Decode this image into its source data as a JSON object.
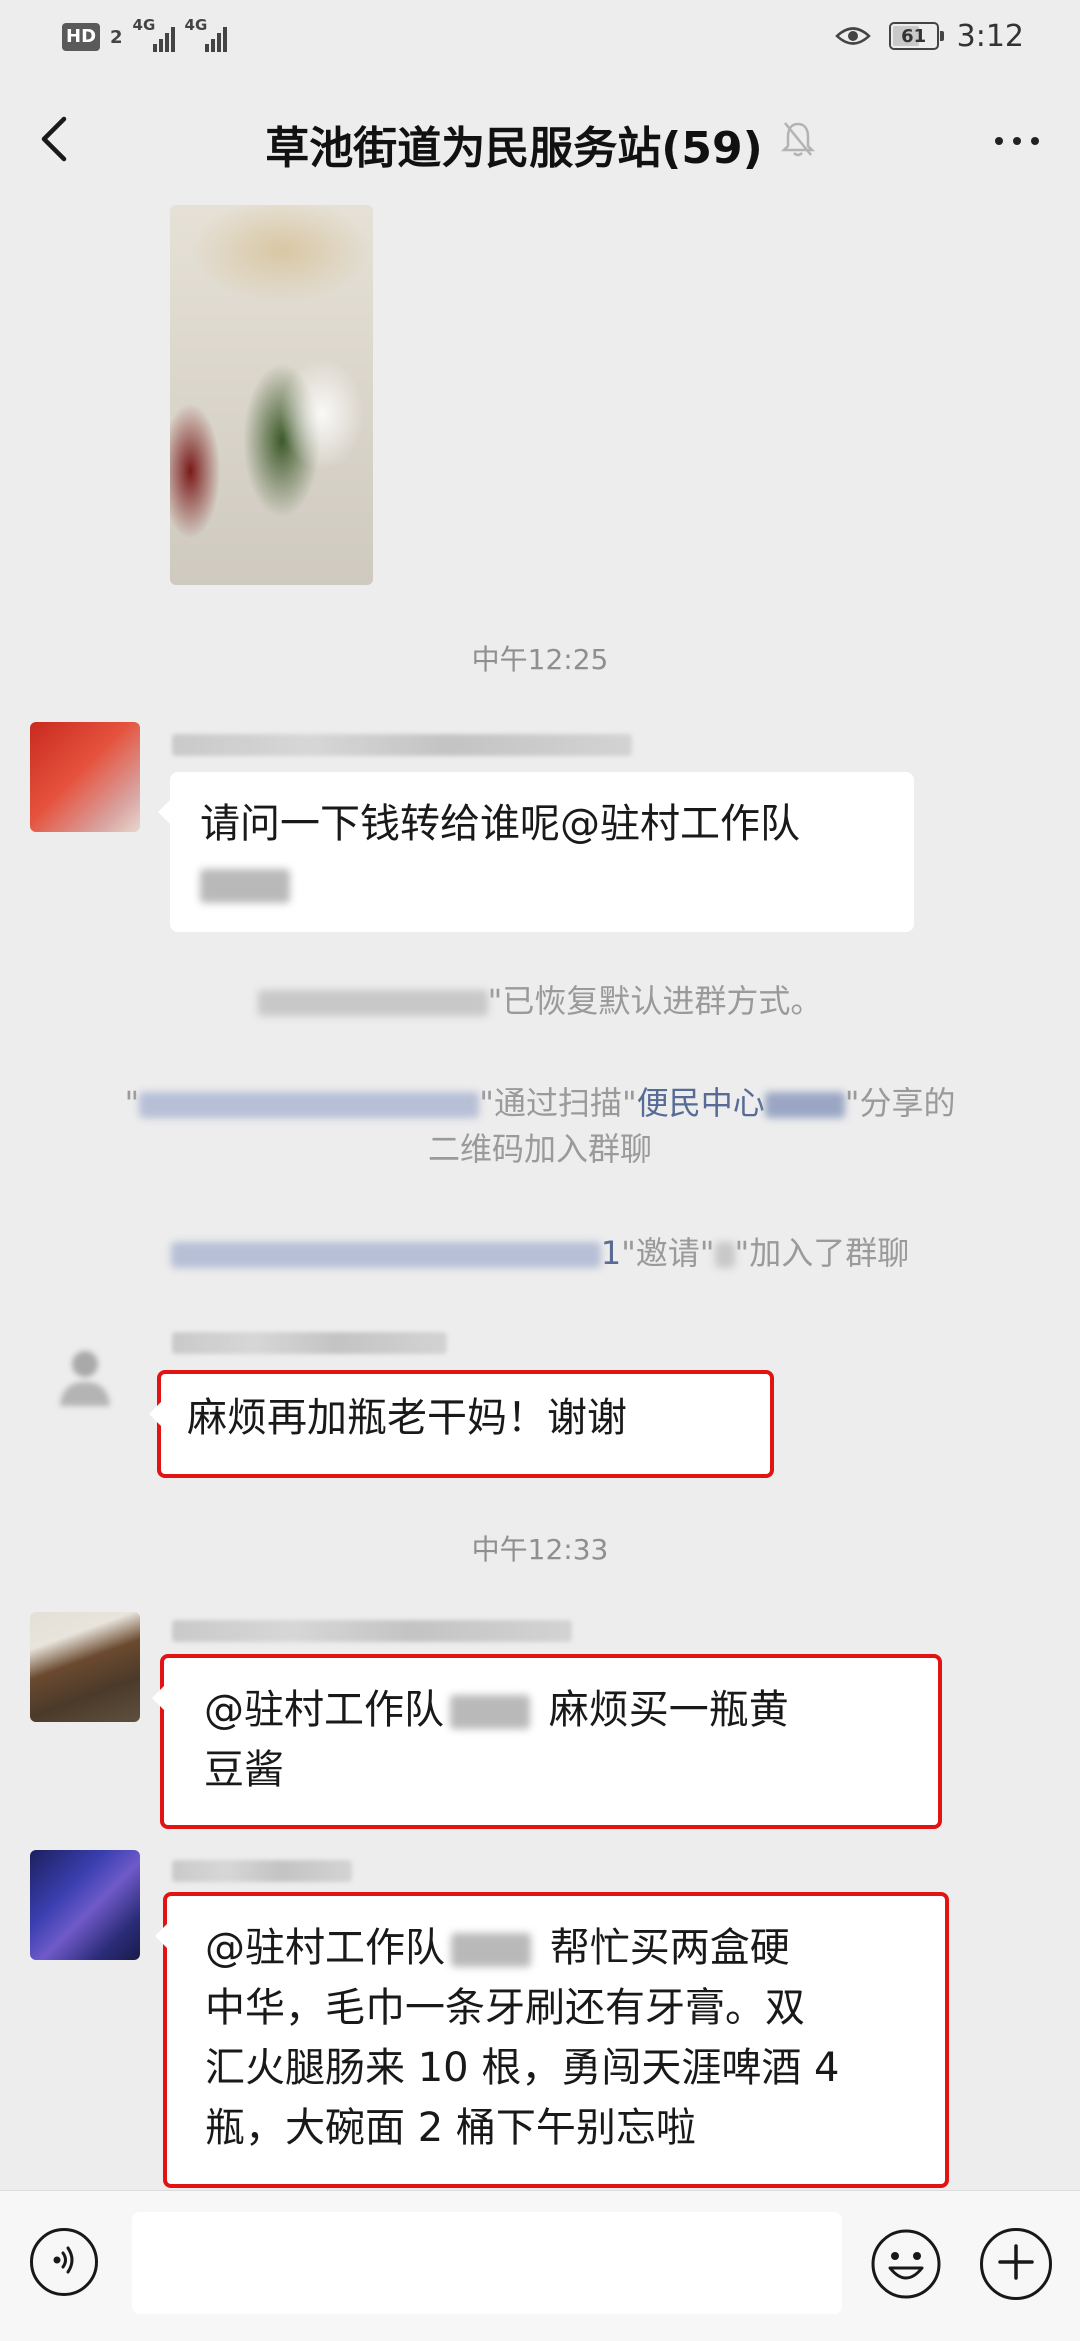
{
  "status_bar": {
    "hd_label": "HD",
    "hd_sim": "2",
    "network_1": "4G",
    "network_2": "4G",
    "battery_level": "61",
    "time": "3:12"
  },
  "header": {
    "title": "草池街道为民服务站(59)",
    "back_icon": "chevron-left-icon",
    "mute_icon": "bell-off-icon",
    "more_icon": "more-horizontal-icon"
  },
  "chat": {
    "time_1": "中午12:25",
    "msg_1": {
      "text_line1": "请问一下钱转给谁呢@驻村工作队"
    },
    "sys_1": "\"\"已恢复默认进群方式。",
    "sys_1_text": "\"已恢复默认进群方式。",
    "sys_2": {
      "prefix": "\"",
      "through": "\"通过扫描\"",
      "link": "便民中心",
      "suffix": "\"分享的",
      "line2": "二维码加入群聊"
    },
    "sys_3": {
      "num_tail": "1",
      "invite": "\"邀请\"",
      "joined": "\"加入了群聊"
    },
    "msg_2": {
      "text": "麻烦再加瓶老干妈！谢谢"
    },
    "time_2": "中午12:33",
    "msg_3": {
      "text_a": "@驻村工作队",
      "text_b": "麻烦买一瓶黄",
      "text_c": "豆酱"
    },
    "msg_4": {
      "text_a": "@驻村工作队",
      "text_b": "帮忙买两盒硬",
      "line2": "中华，毛巾一条牙刷还有牙膏。双",
      "line3": "汇火腿肠来 10 根，勇闯天涯啤酒 4",
      "line4": "瓶，大碗面 2 桶下午别忘啦"
    }
  },
  "input_bar": {
    "voice_icon": "voice-icon",
    "emoji_icon": "emoji-icon",
    "plus_icon": "plus-circle-icon",
    "input_value": ""
  }
}
